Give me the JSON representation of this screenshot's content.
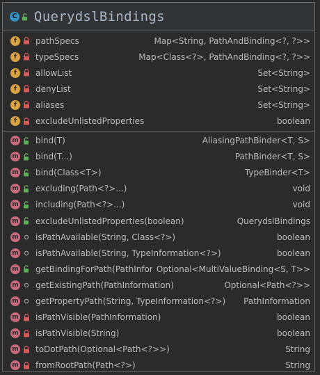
{
  "class": {
    "kind_letter": "C",
    "name": "QuerydslBindings"
  },
  "fields": [
    {
      "kind": "f",
      "visibility": "private",
      "name": "pathSpecs",
      "type": "Map<String, PathAndBinding<?, ?>>"
    },
    {
      "kind": "f",
      "visibility": "private",
      "name": "typeSpecs",
      "type": "Map<Class<?>, PathAndBinding<?, ?>>"
    },
    {
      "kind": "f",
      "visibility": "private",
      "name": "allowList",
      "type": "Set<String>"
    },
    {
      "kind": "f",
      "visibility": "private",
      "name": "denyList",
      "type": "Set<String>"
    },
    {
      "kind": "f",
      "visibility": "private",
      "name": "aliases",
      "type": "Set<String>"
    },
    {
      "kind": "f",
      "visibility": "private",
      "name": "excludeUnlistedProperties",
      "type": "boolean"
    }
  ],
  "methods": [
    {
      "kind": "m",
      "visibility": "public",
      "name": "bind(T)",
      "type": "AliasingPathBinder<T, S>"
    },
    {
      "kind": "m",
      "visibility": "public",
      "name": "bind(T...)",
      "type": "PathBinder<T, S>"
    },
    {
      "kind": "m",
      "visibility": "public",
      "name": "bind(Class<T>)",
      "type": "TypeBinder<T>"
    },
    {
      "kind": "m",
      "visibility": "public",
      "name": "excluding(Path<?>...)",
      "type": "void"
    },
    {
      "kind": "m",
      "visibility": "public",
      "name": "including(Path<?>...)",
      "type": "void"
    },
    {
      "kind": "m",
      "visibility": "public",
      "name": "excludeUnlistedProperties(boolean)",
      "type": "QuerydslBindings"
    },
    {
      "kind": "m",
      "visibility": "package",
      "name": "isPathAvailable(String, Class<?>)",
      "type": "boolean"
    },
    {
      "kind": "m",
      "visibility": "package",
      "name": "isPathAvailable(String, TypeInformation<?>)",
      "type": "boolean"
    },
    {
      "kind": "m",
      "visibility": "public",
      "name": "getBindingForPath(PathInformation)",
      "type": "Optional<MultiValueBinding<S, T>>"
    },
    {
      "kind": "m",
      "visibility": "package",
      "name": "getExistingPath(PathInformation)",
      "type": "Optional<Path<?>>"
    },
    {
      "kind": "m",
      "visibility": "package",
      "name": "getPropertyPath(String, TypeInformation<?>)",
      "type": "PathInformation"
    },
    {
      "kind": "m",
      "visibility": "private",
      "name": "isPathVisible(PathInformation)",
      "type": "boolean"
    },
    {
      "kind": "m",
      "visibility": "private",
      "name": "isPathVisible(String)",
      "type": "boolean"
    },
    {
      "kind": "m",
      "visibility": "private",
      "name": "toDotPath(Optional<Path<?>>)",
      "type": "String"
    },
    {
      "kind": "m",
      "visibility": "private",
      "name": "fromRootPath(Path<?>)",
      "type": "String"
    }
  ],
  "colors": {
    "field_icon": "#d9a343",
    "method_icon": "#c76b7d",
    "class_icon": "#3592c4",
    "private_lock": "#d65b5b",
    "public_lock": "#5fae5f",
    "package_dot": "#9a9a9a"
  }
}
